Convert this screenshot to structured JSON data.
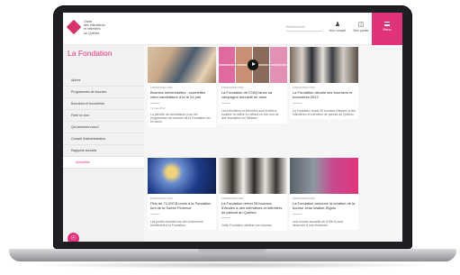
{
  "header": {
    "logo_lines": [
      "Ordre",
      "des infirmières",
      "et infirmiers",
      "du Québec"
    ],
    "search_placeholder": "Rechercher",
    "account_label": "Mon compte",
    "cart_label": "Mon panier",
    "menu_label": "Menu"
  },
  "sidebar": {
    "title": "La Fondation",
    "items": [
      {
        "label": "Autres"
      },
      {
        "label": "Programmes de bourses"
      },
      {
        "label": "Boursiers et boursières"
      },
      {
        "label": "Faire un don"
      },
      {
        "label": "Qui sommes-nous?"
      },
      {
        "label": "Conseil d'administration"
      },
      {
        "label": "Rapports annuels"
      },
      {
        "label": "Actualités",
        "active": true
      }
    ]
  },
  "cards": [
    {
      "category": "FONDATION OIIQ",
      "title": "Bourses universitaires : soumettez votre candidature d'ici le 24 juin",
      "date": "13 mai 2022",
      "excerpt": "La période de candidature pour les programmes de bourses de la Fondation est en cours."
    },
    {
      "category": "FONDATION OIIQ",
      "title": "La Fondation de l'OIIQ lance sa campagne annuelle de dons",
      "date": "",
      "excerpt": "Les infirmières et infirmiers sont invités à soutenir la relève en offrant un don lors de leur inscription au Tableau."
    },
    {
      "category": "FONDATION OIIQ",
      "title": "La Fondation dévoile ses boursiers et boursières 2022",
      "date": "",
      "excerpt": "La Fondation remet 26 bourses d'études à des infirmières et infirmiers de partout au Québec."
    },
    {
      "category": "FONDATION OIIQ",
      "title": "Plus de 74 000 $ remis à la Fondation lors de la Soirée Florence",
      "date": "",
      "excerpt": "Les profits récoltés lors de l'événement bénéficient à la Fondation."
    },
    {
      "category": "FONDATION OIIQ",
      "title": "La Fondation remet 26 bourses d'études à des infirmières et infirmiers de partout au Québec",
      "date": "",
      "excerpt": "Cette Fondation attribue ces bourses."
    },
    {
      "category": "FONDATION OIIQ",
      "title": "La Fondation annonce la création de la bourse Jean Walker-Rigolo",
      "date": "",
      "excerpt": "Une bourse annuelle de 5 000 $ sera décernée à une étudiante."
    }
  ]
}
